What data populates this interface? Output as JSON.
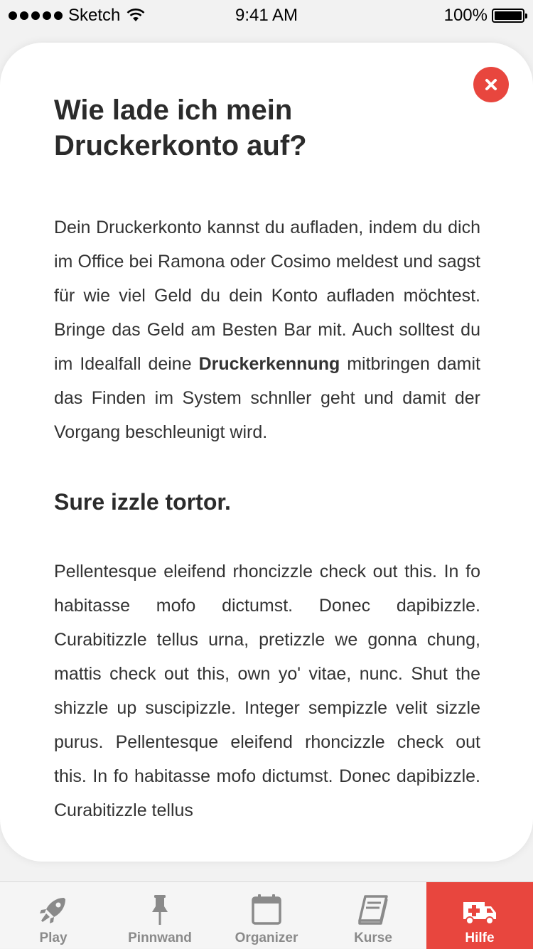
{
  "status_bar": {
    "carrier": "Sketch",
    "time": "9:41 AM",
    "battery": "100%"
  },
  "article": {
    "title": "Wie lade ich mein Druckerkonto auf?",
    "paragraph1_before": "Dein Druckerkonto kannst du aufladen, indem du dich im Office bei Ramona oder Cosimo meldest und sagst für wie viel Geld du dein Konto aufladen möchtest. Bringe das Geld am Besten Bar mit. Auch solltest du im Idealfall deine ",
    "paragraph1_bold": "Druckerkennung",
    "paragraph1_after": " mitbringen damit das Finden im System schnller geht und damit der Vorgang beschleunigt wird.",
    "subtitle": "Sure izzle tortor.",
    "paragraph2": "Pellentesque eleifend rhoncizzle check out this. In fo habitasse mofo dictumst. Donec dapibizzle. Curabitizzle tellus urna, pretizzle we gonna chung, mattis check out this, own yo' vitae, nunc. Shut the shizzle up suscipizzle. Integer sempizzle velit sizzle purus. Pellentesque eleifend rhoncizzle check out this. In fo habitasse mofo dictumst. Donec dapibizzle. Curabitizzle tellus"
  },
  "close_button": {
    "icon": "close-icon",
    "color": "#e8463e"
  },
  "tabbar": {
    "accent": "#e8463e",
    "items": [
      {
        "label": "Play",
        "icon": "rocket-icon",
        "active": false
      },
      {
        "label": "Pinnwand",
        "icon": "pin-icon",
        "active": false
      },
      {
        "label": "Organizer",
        "icon": "calendar-icon",
        "active": false
      },
      {
        "label": "Kurse",
        "icon": "book-icon",
        "active": false
      },
      {
        "label": "Hilfe",
        "icon": "ambulance-icon",
        "active": true
      }
    ]
  }
}
